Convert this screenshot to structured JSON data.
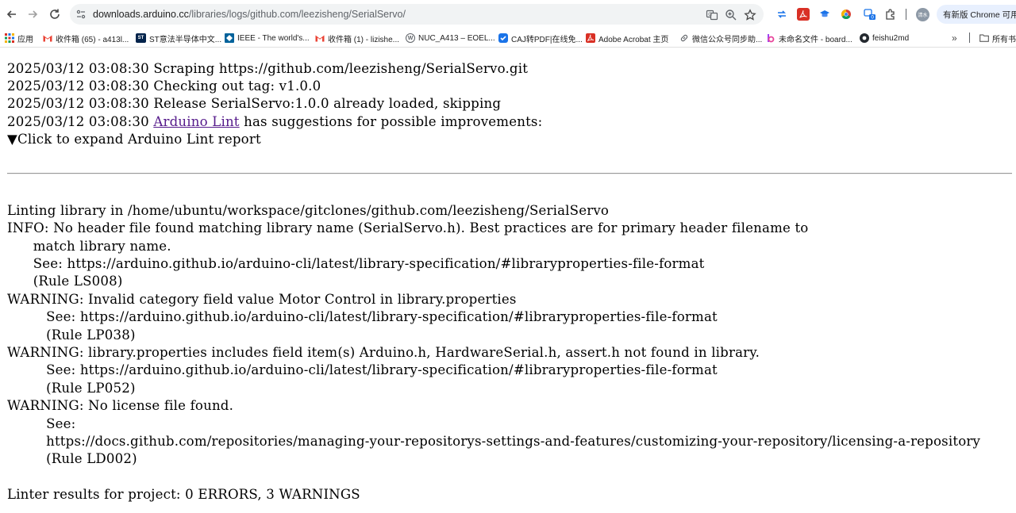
{
  "browser": {
    "url_host": "downloads.arduino.cc",
    "url_path": "/libraries/logs/github.com/leezisheng/SerialServo/",
    "update_button": "有新版 Chrome 可用",
    "profile_badge": "清水",
    "ext_badge": "0"
  },
  "bookmarks": [
    {
      "label": "应用",
      "icon": "apps-grid-icon",
      "color": "#4285f4"
    },
    {
      "label": "收件箱 (65) - a413l...",
      "icon": "gmail-icon",
      "color": "#ea4335"
    },
    {
      "label": "ST意法半导体中文...",
      "icon": "st-logo-icon",
      "color": "#03234b"
    },
    {
      "label": "IEEE - The world's...",
      "icon": "ieee-icon",
      "color": "#00629b"
    },
    {
      "label": "收件箱 (1) - lizishe...",
      "icon": "gmail-icon",
      "color": "#ea4335"
    },
    {
      "label": "NUC_A413 – EOEL...",
      "icon": "wordpress-icon",
      "color": "#21759b"
    },
    {
      "label": "CAJ转PDF|在线免...",
      "icon": "caj-icon",
      "color": "#1a73e8"
    },
    {
      "label": "Adobe Acrobat 主页",
      "icon": "acrobat-icon",
      "color": "#d93025"
    },
    {
      "label": "微信公众号同步助...",
      "icon": "link-icon",
      "color": "#5f6368"
    },
    {
      "label": "未命名文件 - board...",
      "icon": "boardmix-icon",
      "color": "#a142f4"
    },
    {
      "label": "feishu2md",
      "icon": "github-icon",
      "color": "#24292f"
    },
    {
      "label": "所有书",
      "icon": "folder-icon",
      "color": "#5f6368"
    }
  ],
  "log": {
    "header_lines": [
      "2025/03/12 03:08:30 Scraping https://github.com/leezisheng/SerialServo.git",
      "2025/03/12 03:08:30 Checking out tag: v1.0.0",
      "2025/03/12 03:08:30 Release SerialServo:1.0.0 already loaded, skipping"
    ],
    "lint_prefix": "2025/03/12 03:08:30 ",
    "lint_link": "Arduino Lint",
    "lint_suffix": " has suggestions for possible improvements:",
    "expand_toggle": "▼Click to expand Arduino Lint report",
    "report_lines": [
      "Linting library in /home/ubuntu/workspace/gitclones/github.com/leezisheng/SerialServo",
      "INFO: No header file found matching library name (SerialServo.h). Best practices are for primary header filename to",
      "      match library name.",
      "      See: https://arduino.github.io/arduino-cli/latest/library-specification/#libraryproperties-file-format",
      "      (Rule LS008)",
      "WARNING: Invalid category field value Motor Control in library.properties",
      "         See: https://arduino.github.io/arduino-cli/latest/library-specification/#libraryproperties-file-format",
      "         (Rule LP038)",
      "WARNING: library.properties includes field item(s) Arduino.h, HardwareSerial.h, assert.h not found in library.",
      "         See: https://arduino.github.io/arduino-cli/latest/library-specification/#libraryproperties-file-format",
      "         (Rule LP052)",
      "WARNING: No license file found.",
      "         See:",
      "         https://docs.github.com/repositories/managing-your-repositorys-settings-and-features/customizing-your-repository/licensing-a-repository",
      "         (Rule LD002)",
      "",
      "Linter results for project: 0 ERRORS, 3 WARNINGS"
    ]
  }
}
